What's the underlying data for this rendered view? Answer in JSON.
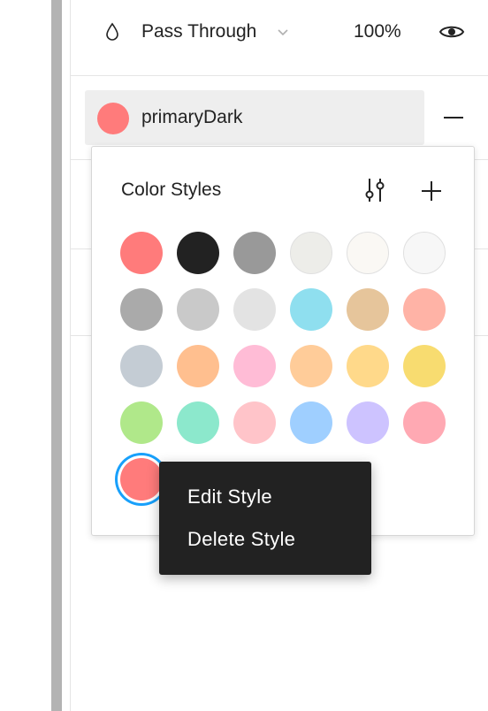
{
  "layer": {
    "blend_icon": "drop-icon",
    "blend_mode": "Pass Through",
    "opacity": "100%",
    "visibility_icon": "eye-icon"
  },
  "fill_style": {
    "name": "primaryDark",
    "color": "#ff7b7b",
    "remove_icon": "minus-icon"
  },
  "popover": {
    "title": "Color Styles",
    "adjust_icon": "adjust-icon",
    "add_icon": "plus-icon",
    "swatches": [
      "#ff7b7b",
      "#222222",
      "#999999",
      "#edede9",
      "#faf8f4",
      "#f7f7f7",
      "#aaaaaa",
      "#c9c9c9",
      "#e3e3e3",
      "#8fdfef",
      "#e6c59b",
      "#ffb3a6",
      "#c4ccd4",
      "#ffbf8f",
      "#ffbcd6",
      "#ffcc99",
      "#ffd98a",
      "#f8dc70",
      "#b0e88a",
      "#8ce8cc",
      "#ffc4c9",
      "#9fcfff",
      "#cdc3ff",
      "#ffa9b3",
      "#ff7b7b"
    ],
    "selected_index": 24
  },
  "context_menu": {
    "items": [
      "Edit Style",
      "Delete Style"
    ]
  }
}
